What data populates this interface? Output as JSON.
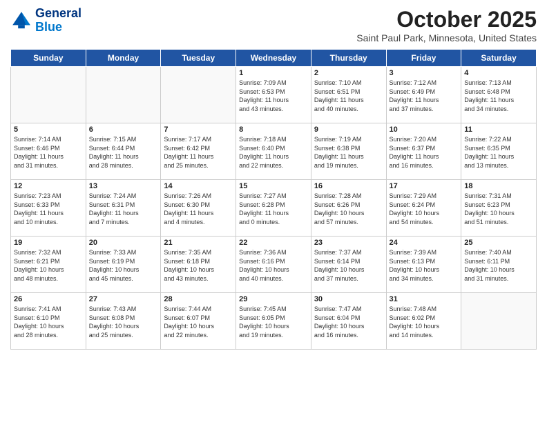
{
  "header": {
    "logo_line1": "General",
    "logo_line2": "Blue",
    "month_title": "October 2025",
    "location": "Saint Paul Park, Minnesota, United States"
  },
  "weekdays": [
    "Sunday",
    "Monday",
    "Tuesday",
    "Wednesday",
    "Thursday",
    "Friday",
    "Saturday"
  ],
  "weeks": [
    [
      {
        "day": "",
        "info": "",
        "empty": true
      },
      {
        "day": "",
        "info": "",
        "empty": true
      },
      {
        "day": "",
        "info": "",
        "empty": true
      },
      {
        "day": "1",
        "info": "Sunrise: 7:09 AM\nSunset: 6:53 PM\nDaylight: 11 hours\nand 43 minutes.",
        "empty": false
      },
      {
        "day": "2",
        "info": "Sunrise: 7:10 AM\nSunset: 6:51 PM\nDaylight: 11 hours\nand 40 minutes.",
        "empty": false
      },
      {
        "day": "3",
        "info": "Sunrise: 7:12 AM\nSunset: 6:49 PM\nDaylight: 11 hours\nand 37 minutes.",
        "empty": false
      },
      {
        "day": "4",
        "info": "Sunrise: 7:13 AM\nSunset: 6:48 PM\nDaylight: 11 hours\nand 34 minutes.",
        "empty": false
      }
    ],
    [
      {
        "day": "5",
        "info": "Sunrise: 7:14 AM\nSunset: 6:46 PM\nDaylight: 11 hours\nand 31 minutes.",
        "empty": false
      },
      {
        "day": "6",
        "info": "Sunrise: 7:15 AM\nSunset: 6:44 PM\nDaylight: 11 hours\nand 28 minutes.",
        "empty": false
      },
      {
        "day": "7",
        "info": "Sunrise: 7:17 AM\nSunset: 6:42 PM\nDaylight: 11 hours\nand 25 minutes.",
        "empty": false
      },
      {
        "day": "8",
        "info": "Sunrise: 7:18 AM\nSunset: 6:40 PM\nDaylight: 11 hours\nand 22 minutes.",
        "empty": false
      },
      {
        "day": "9",
        "info": "Sunrise: 7:19 AM\nSunset: 6:38 PM\nDaylight: 11 hours\nand 19 minutes.",
        "empty": false
      },
      {
        "day": "10",
        "info": "Sunrise: 7:20 AM\nSunset: 6:37 PM\nDaylight: 11 hours\nand 16 minutes.",
        "empty": false
      },
      {
        "day": "11",
        "info": "Sunrise: 7:22 AM\nSunset: 6:35 PM\nDaylight: 11 hours\nand 13 minutes.",
        "empty": false
      }
    ],
    [
      {
        "day": "12",
        "info": "Sunrise: 7:23 AM\nSunset: 6:33 PM\nDaylight: 11 hours\nand 10 minutes.",
        "empty": false
      },
      {
        "day": "13",
        "info": "Sunrise: 7:24 AM\nSunset: 6:31 PM\nDaylight: 11 hours\nand 7 minutes.",
        "empty": false
      },
      {
        "day": "14",
        "info": "Sunrise: 7:26 AM\nSunset: 6:30 PM\nDaylight: 11 hours\nand 4 minutes.",
        "empty": false
      },
      {
        "day": "15",
        "info": "Sunrise: 7:27 AM\nSunset: 6:28 PM\nDaylight: 11 hours\nand 0 minutes.",
        "empty": false
      },
      {
        "day": "16",
        "info": "Sunrise: 7:28 AM\nSunset: 6:26 PM\nDaylight: 10 hours\nand 57 minutes.",
        "empty": false
      },
      {
        "day": "17",
        "info": "Sunrise: 7:29 AM\nSunset: 6:24 PM\nDaylight: 10 hours\nand 54 minutes.",
        "empty": false
      },
      {
        "day": "18",
        "info": "Sunrise: 7:31 AM\nSunset: 6:23 PM\nDaylight: 10 hours\nand 51 minutes.",
        "empty": false
      }
    ],
    [
      {
        "day": "19",
        "info": "Sunrise: 7:32 AM\nSunset: 6:21 PM\nDaylight: 10 hours\nand 48 minutes.",
        "empty": false
      },
      {
        "day": "20",
        "info": "Sunrise: 7:33 AM\nSunset: 6:19 PM\nDaylight: 10 hours\nand 45 minutes.",
        "empty": false
      },
      {
        "day": "21",
        "info": "Sunrise: 7:35 AM\nSunset: 6:18 PM\nDaylight: 10 hours\nand 43 minutes.",
        "empty": false
      },
      {
        "day": "22",
        "info": "Sunrise: 7:36 AM\nSunset: 6:16 PM\nDaylight: 10 hours\nand 40 minutes.",
        "empty": false
      },
      {
        "day": "23",
        "info": "Sunrise: 7:37 AM\nSunset: 6:14 PM\nDaylight: 10 hours\nand 37 minutes.",
        "empty": false
      },
      {
        "day": "24",
        "info": "Sunrise: 7:39 AM\nSunset: 6:13 PM\nDaylight: 10 hours\nand 34 minutes.",
        "empty": false
      },
      {
        "day": "25",
        "info": "Sunrise: 7:40 AM\nSunset: 6:11 PM\nDaylight: 10 hours\nand 31 minutes.",
        "empty": false
      }
    ],
    [
      {
        "day": "26",
        "info": "Sunrise: 7:41 AM\nSunset: 6:10 PM\nDaylight: 10 hours\nand 28 minutes.",
        "empty": false
      },
      {
        "day": "27",
        "info": "Sunrise: 7:43 AM\nSunset: 6:08 PM\nDaylight: 10 hours\nand 25 minutes.",
        "empty": false
      },
      {
        "day": "28",
        "info": "Sunrise: 7:44 AM\nSunset: 6:07 PM\nDaylight: 10 hours\nand 22 minutes.",
        "empty": false
      },
      {
        "day": "29",
        "info": "Sunrise: 7:45 AM\nSunset: 6:05 PM\nDaylight: 10 hours\nand 19 minutes.",
        "empty": false
      },
      {
        "day": "30",
        "info": "Sunrise: 7:47 AM\nSunset: 6:04 PM\nDaylight: 10 hours\nand 16 minutes.",
        "empty": false
      },
      {
        "day": "31",
        "info": "Sunrise: 7:48 AM\nSunset: 6:02 PM\nDaylight: 10 hours\nand 14 minutes.",
        "empty": false
      },
      {
        "day": "",
        "info": "",
        "empty": true
      }
    ]
  ]
}
